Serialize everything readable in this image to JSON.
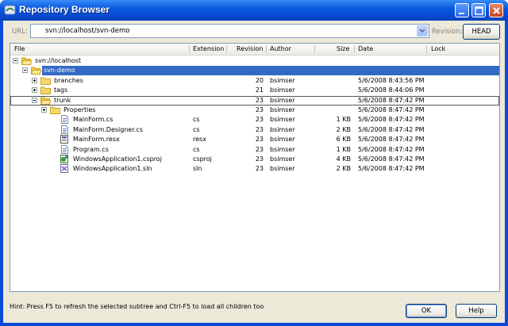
{
  "window": {
    "title": "Repository Browser"
  },
  "toolbar": {
    "url_label": "URL:",
    "url_value": "svn://localhost/svn-demo",
    "revision_label": "Revision:",
    "head_button": "HEAD"
  },
  "columns": {
    "file": "File",
    "extension": "Extension",
    "revision": "Revision",
    "author": "Author",
    "size": "Size",
    "date": "Date",
    "lock": "Lock"
  },
  "rows": [
    {
      "name": "svn://localhost",
      "icon": "folder-open-icon",
      "expander": "minus",
      "ext": "",
      "rev": "",
      "author": "",
      "size": "",
      "date": "",
      "lock": ""
    },
    {
      "name": "svn-demo",
      "icon": "folder-open-icon",
      "expander": "minus",
      "ext": "",
      "rev": "",
      "author": "",
      "size": "",
      "date": "",
      "lock": ""
    },
    {
      "name": "branches",
      "icon": "folder-icon",
      "expander": "plus",
      "ext": "",
      "rev": "20",
      "author": "bsimser",
      "size": "",
      "date": "5/6/2008 8:43:56 PM",
      "lock": ""
    },
    {
      "name": "tags",
      "icon": "folder-icon",
      "expander": "plus",
      "ext": "",
      "rev": "21",
      "author": "bsimser",
      "size": "",
      "date": "5/6/2008 8:44:06 PM",
      "lock": ""
    },
    {
      "name": "trunk",
      "icon": "folder-open-icon",
      "expander": "minus",
      "ext": "",
      "rev": "23",
      "author": "bsimser",
      "size": "",
      "date": "5/6/2008 8:47:42 PM",
      "lock": ""
    },
    {
      "name": "Properties",
      "icon": "folder-icon",
      "expander": "plus",
      "ext": "",
      "rev": "23",
      "author": "bsimser",
      "size": "",
      "date": "5/6/2008 8:47:42 PM",
      "lock": ""
    },
    {
      "name": "MainForm.cs",
      "icon": "cs-file-icon",
      "expander": "",
      "ext": "cs",
      "rev": "23",
      "author": "bsimser",
      "size": "1 KB",
      "date": "5/6/2008 8:47:42 PM",
      "lock": ""
    },
    {
      "name": "MainForm.Designer.cs",
      "icon": "cs-file-icon",
      "expander": "",
      "ext": "cs",
      "rev": "23",
      "author": "bsimser",
      "size": "2 KB",
      "date": "5/6/2008 8:47:42 PM",
      "lock": ""
    },
    {
      "name": "MainForm.resx",
      "icon": "resx-file-icon",
      "expander": "",
      "ext": "resx",
      "rev": "23",
      "author": "bsimser",
      "size": "6 KB",
      "date": "5/6/2008 8:47:42 PM",
      "lock": ""
    },
    {
      "name": "Program.cs",
      "icon": "cs-file-icon",
      "expander": "",
      "ext": "cs",
      "rev": "23",
      "author": "bsimser",
      "size": "1 KB",
      "date": "5/6/2008 8:47:42 PM",
      "lock": ""
    },
    {
      "name": "WindowsApplication1.csproj",
      "icon": "csproj-file-icon",
      "expander": "",
      "ext": "csproj",
      "rev": "23",
      "author": "bsimser",
      "size": "4 KB",
      "date": "5/6/2008 8:47:42 PM",
      "lock": ""
    },
    {
      "name": "WindowsApplication1.sln",
      "icon": "sln-file-icon",
      "expander": "",
      "ext": "sln",
      "rev": "23",
      "author": "bsimser",
      "size": "2 KB",
      "date": "5/6/2008 8:47:42 PM",
      "lock": ""
    }
  ],
  "footer": {
    "hint": "Hint: Press F5 to refresh the selected subtree and Ctrl-F5 to load all children too",
    "ok_button": "OK",
    "help_button": "Help"
  },
  "colors": {
    "selection": "#316ac5",
    "titlebar": "#0a5ae0",
    "dialog": "#ece9d8"
  }
}
